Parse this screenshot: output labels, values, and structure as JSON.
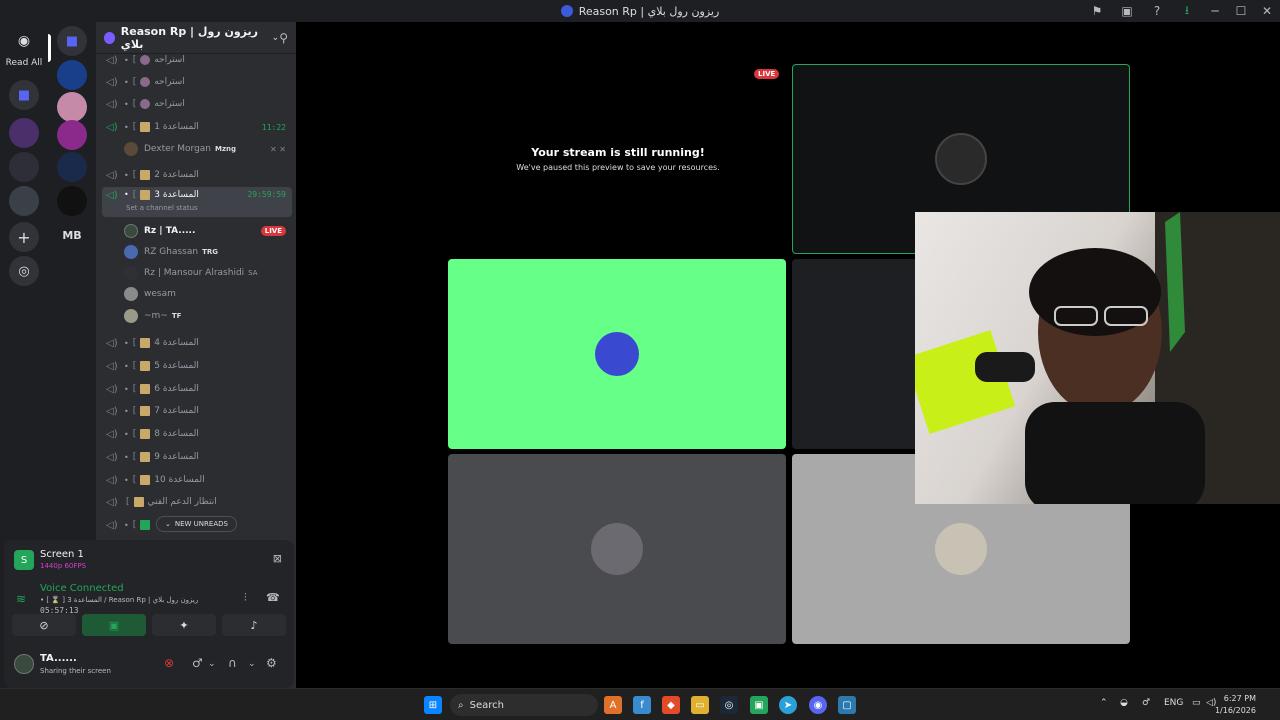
{
  "window": {
    "title": "Reason Rp | ريزون رول بلاي"
  },
  "rail": {
    "read_all": "Read All"
  },
  "server": {
    "name": "Reason Rp | ريزون رول بلاي"
  },
  "channels": [
    {
      "label": "استراحه",
      "bracket": "[",
      "type": "emoji"
    },
    {
      "label": "استراحه",
      "bracket": "[",
      "type": "emoji"
    },
    {
      "label": "استراحه",
      "bracket": "[",
      "type": "emoji"
    },
    {
      "label": "المساعدة 1",
      "bracket": "[",
      "type": "hg",
      "timer": "11:22",
      "active_voice": true
    },
    {
      "label": "المساعدة 2",
      "bracket": "[",
      "type": "hg"
    },
    {
      "label": "المساعدة 3",
      "bracket": "[",
      "type": "hg",
      "timer": "29:59:59",
      "active_voice": true,
      "selected": true,
      "status": "Set a channel status"
    },
    {
      "label": "المساعدة 4",
      "bracket": "[",
      "type": "hg"
    },
    {
      "label": "المساعدة 5",
      "bracket": "[",
      "type": "hg"
    },
    {
      "label": "المساعدة 6",
      "bracket": "[",
      "type": "hg"
    },
    {
      "label": "المساعدة 7",
      "bracket": "[",
      "type": "hg"
    },
    {
      "label": "المساعدة 8",
      "bracket": "[",
      "type": "hg"
    },
    {
      "label": "المساعدة 9",
      "bracket": "[",
      "type": "hg"
    },
    {
      "label": "المساعدة 10",
      "bracket": "[",
      "type": "hg"
    },
    {
      "label": "انتظار الدعم الفني",
      "bracket": "[",
      "type": "hg"
    },
    {
      "label": "",
      "bracket": "[",
      "type": "check"
    }
  ],
  "users_ch1": [
    {
      "name": "Dexter Morgan",
      "tag": "Mzng",
      "muted": true
    }
  ],
  "users_ch3": [
    {
      "name": "Rz  |  TA.....",
      "live": "LIVE",
      "bold": true
    },
    {
      "name": "RZ Ghassan",
      "tag": "TRG"
    },
    {
      "name": "Rz | Mansour Alrashidi",
      "tag": "SA"
    },
    {
      "name": "wesam"
    },
    {
      "name": "~m~",
      "tag": "TF"
    }
  ],
  "new_unreads": "NEW UNREADS",
  "screen_panel": {
    "title": "Screen 1",
    "quality": "1440p 60FPS"
  },
  "voice_panel": {
    "status": "Voice Connected",
    "channel": "• [ ⌛ ] المساعدة 3 / Reason Rp | ريزون رول بلاي",
    "time": "05:57:13"
  },
  "user_panel": {
    "name": "TA......",
    "status": "Sharing their screen"
  },
  "stage": {
    "live": "LIVE",
    "paused_title": "Your stream is still running!",
    "paused_sub": "We've paused this preview to save your resources."
  },
  "taskbar": {
    "search": "Search",
    "lang": "ENG",
    "time": "6:27 PM",
    "date": "1/16/2026"
  },
  "colors": {
    "green_tile": "#66ff88",
    "gray_tile": "#4a4b4f",
    "light_tile": "#a9a9a9",
    "accent_green": "#23a55a",
    "live_red": "#da373c"
  }
}
